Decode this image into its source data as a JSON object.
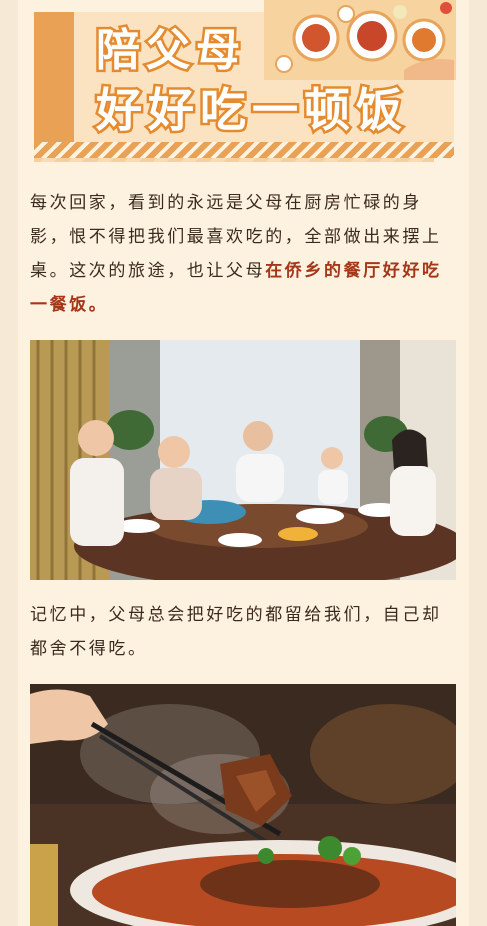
{
  "banner": {
    "title_line1": "陪父母",
    "title_line2": "好好吃一顿饭"
  },
  "paragraph1": {
    "text": "每次回家，看到的永远是父母在厨房忙碌的身影，恨不得把我们最喜欢吃的，全部做出来摆上桌。这次的旅途，也让父母",
    "highlight": "在侨乡的餐厅好好吃一餐饭。"
  },
  "paragraph2": {
    "text": "记忆中，父母总会把好吃的都留给我们，自己却都舍不得吃。"
  },
  "colors": {
    "page_background": "#fdf2df",
    "banner_orange": "#e48b2f",
    "highlight_text": "#a4371a",
    "body_text": "#3b2a1f"
  }
}
